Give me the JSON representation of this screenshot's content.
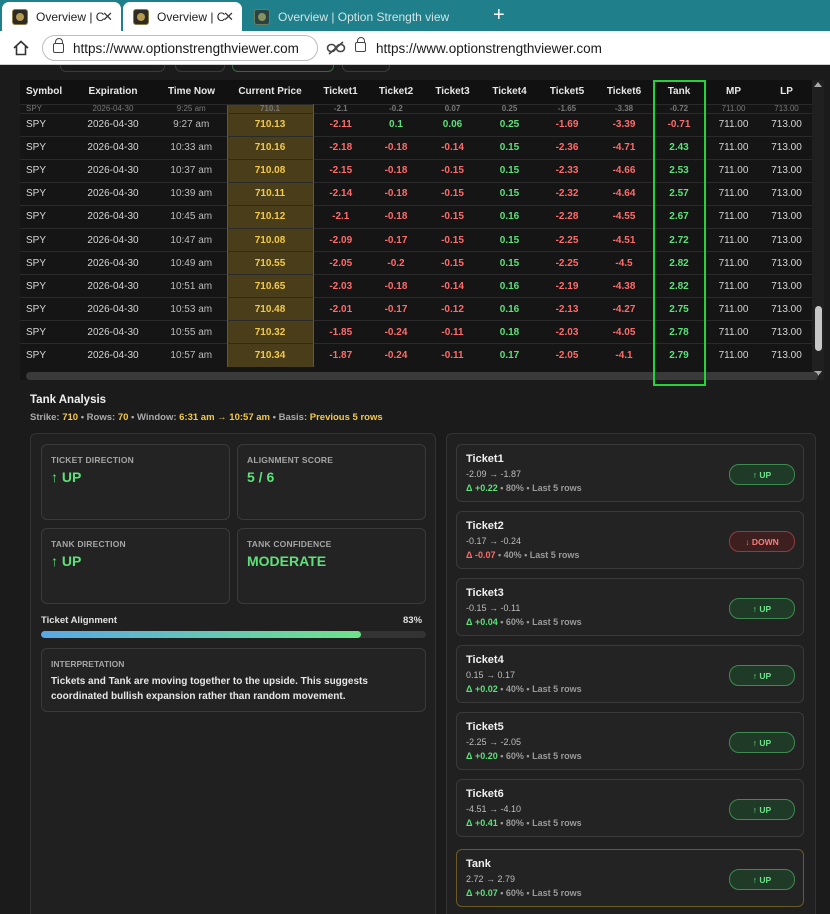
{
  "browser": {
    "tabs": [
      {
        "label": "Overview | C",
        "active": true
      },
      {
        "label": "Overview | C",
        "active": true
      },
      {
        "label": "Overview | Option Strength view",
        "active": false
      }
    ],
    "close_glyph": "✕",
    "newtab_glyph": "+",
    "url_left": "https://www.optionstrengthviewer.com",
    "url_right": "https://www.optionstrengthviewer.com"
  },
  "table": {
    "headers": [
      "Symbol",
      "Expiration",
      "Time Now",
      "Current Price",
      "Ticket1",
      "Ticket2",
      "Ticket3",
      "Ticket4",
      "Ticket5",
      "Ticket6",
      "Tank",
      "MP",
      "LP"
    ],
    "partial_row": [
      "SPY",
      "2026-04-30",
      "9:25 am",
      "710.1",
      "-2.1",
      "-0.2",
      "0.07",
      "0.25",
      "-1.65",
      "-3.38",
      "-0.72",
      "711.00",
      "713.00"
    ],
    "rows": [
      [
        "SPY",
        "2026-04-30",
        "9:27 am",
        "710.13",
        "-2.11",
        "0.1",
        "0.06",
        "0.25",
        "-1.69",
        "-3.39",
        "-0.71",
        "711.00",
        "713.00"
      ],
      [
        "SPY",
        "2026-04-30",
        "10:33 am",
        "710.16",
        "-2.18",
        "-0.18",
        "-0.14",
        "0.15",
        "-2.36",
        "-4.71",
        "2.43",
        "711.00",
        "713.00"
      ],
      [
        "SPY",
        "2026-04-30",
        "10:37 am",
        "710.08",
        "-2.15",
        "-0.18",
        "-0.15",
        "0.15",
        "-2.33",
        "-4.66",
        "2.53",
        "711.00",
        "713.00"
      ],
      [
        "SPY",
        "2026-04-30",
        "10:39 am",
        "710.11",
        "-2.14",
        "-0.18",
        "-0.15",
        "0.15",
        "-2.32",
        "-4.64",
        "2.57",
        "711.00",
        "713.00"
      ],
      [
        "SPY",
        "2026-04-30",
        "10:45 am",
        "710.12",
        "-2.1",
        "-0.18",
        "-0.15",
        "0.16",
        "-2.28",
        "-4.55",
        "2.67",
        "711.00",
        "713.00"
      ],
      [
        "SPY",
        "2026-04-30",
        "10:47 am",
        "710.08",
        "-2.09",
        "-0.17",
        "-0.15",
        "0.15",
        "-2.25",
        "-4.51",
        "2.72",
        "711.00",
        "713.00"
      ],
      [
        "SPY",
        "2026-04-30",
        "10:49 am",
        "710.55",
        "-2.05",
        "-0.2",
        "-0.15",
        "0.15",
        "-2.25",
        "-4.5",
        "2.82",
        "711.00",
        "713.00"
      ],
      [
        "SPY",
        "2026-04-30",
        "10:51 am",
        "710.65",
        "-2.03",
        "-0.18",
        "-0.14",
        "0.16",
        "-2.19",
        "-4.38",
        "2.82",
        "711.00",
        "713.00"
      ],
      [
        "SPY",
        "2026-04-30",
        "10:53 am",
        "710.48",
        "-2.01",
        "-0.17",
        "-0.12",
        "0.16",
        "-2.13",
        "-4.27",
        "2.75",
        "711.00",
        "713.00"
      ],
      [
        "SPY",
        "2026-04-30",
        "10:55 am",
        "710.32",
        "-1.85",
        "-0.24",
        "-0.11",
        "0.18",
        "-2.03",
        "-4.05",
        "2.78",
        "711.00",
        "713.00"
      ],
      [
        "SPY",
        "2026-04-30",
        "10:57 am",
        "710.34",
        "-1.87",
        "-0.24",
        "-0.11",
        "0.17",
        "-2.05",
        "-4.1",
        "2.79",
        "711.00",
        "713.00"
      ]
    ]
  },
  "analysis": {
    "title": "Tank Analysis",
    "sub_strike_label": "Strike: ",
    "sub_strike": "710",
    "sub_rows_label": " • Rows: ",
    "sub_rows": "70",
    "sub_window_label": " • Window: ",
    "sub_window": "6:31 am → 10:57 am",
    "sub_basis_label": " • Basis: ",
    "sub_basis": "Previous 5 rows",
    "ticket_direction_label": "TICKET DIRECTION",
    "ticket_direction": "↑ UP",
    "alignment_score_label": "ALIGNMENT SCORE",
    "alignment_score": "5 / 6",
    "tank_direction_label": "TANK DIRECTION",
    "tank_direction": "↑ UP",
    "tank_confidence_label": "TANK CONFIDENCE",
    "tank_confidence": "MODERATE",
    "ticket_alignment_label": "Ticket Alignment",
    "ticket_alignment_pct": "83%",
    "ticket_alignment_value": 0.83,
    "interpretation_label": "INTERPRETATION",
    "interpretation_text": "Tickets and Tank are moving together to the upside. This suggests coordinated bullish expansion rather than random movement."
  },
  "tickets": [
    {
      "name": "Ticket1",
      "range": "-2.09 → -1.87",
      "delta": "Δ +0.22",
      "tail": " • 80% • Last 5 rows",
      "dir": "up",
      "badge": "↑ UP"
    },
    {
      "name": "Ticket2",
      "range": "-0.17 → -0.24",
      "delta": "Δ -0.07",
      "tail": " • 40% • Last 5 rows",
      "dir": "down",
      "badge": "↓ DOWN"
    },
    {
      "name": "Ticket3",
      "range": "-0.15 → -0.11",
      "delta": "Δ +0.04",
      "tail": " • 60% • Last 5 rows",
      "dir": "up",
      "badge": "↑ UP"
    },
    {
      "name": "Ticket4",
      "range": "0.15 → 0.17",
      "delta": "Δ +0.02",
      "tail": " • 40% • Last 5 rows",
      "dir": "up",
      "badge": "↑ UP"
    },
    {
      "name": "Ticket5",
      "range": "-2.25 → -2.05",
      "delta": "Δ +0.20",
      "tail": " • 60% • Last 5 rows",
      "dir": "up",
      "badge": "↑ UP"
    },
    {
      "name": "Ticket6",
      "range": "-4.51 → -4.10",
      "delta": "Δ +0.41",
      "tail": " • 80% • Last 5 rows",
      "dir": "up",
      "badge": "↑ UP"
    },
    {
      "name": "Tank",
      "range": "2.72 → 2.79",
      "delta": "Δ +0.07",
      "tail": " • 60% • Last 5 rows",
      "dir": "up",
      "badge": "↑ UP"
    }
  ],
  "colors": {
    "accent_green": "#5ee07a",
    "accent_red": "#ff6b6b",
    "price_gold": "#f2c94c",
    "highlight_box": "#22d33a"
  }
}
